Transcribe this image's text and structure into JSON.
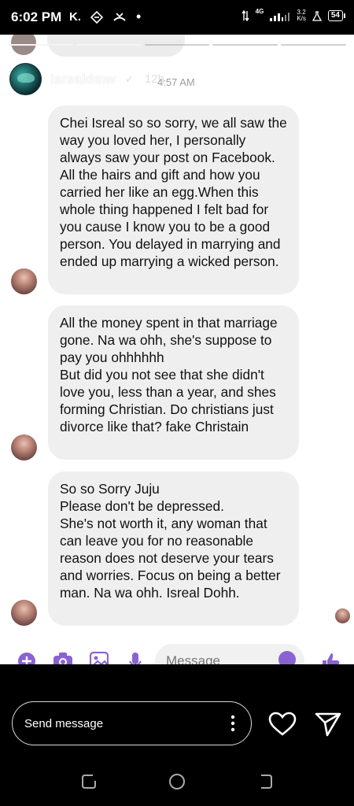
{
  "status_bar": {
    "time": "6:02 PM",
    "left_icons": [
      "K.",
      "data-saver-icon",
      "missed-call-icon",
      "•"
    ],
    "network": "4G",
    "speed_value": "3.2",
    "speed_unit": "K/s",
    "battery": "54"
  },
  "story": {
    "owner_name": "isrealdmw",
    "post_age": "12h",
    "screenshot_time": "4:57 AM"
  },
  "messages": [
    {
      "text": "Chei Isreal so so sorry, we all saw the way you loved her, I personally always saw your post on Facebook. All the hairs and gift and how you carried her like an egg.When this whole thing happened I felt bad for you cause I know you to be a good person. You delayed in marrying and ended up marrying a wicked person."
    },
    {
      "text": "All the money spent in that marriage gone. Na wa ohh, she's suppose to pay you ohhhhhh\nBut did you not see that she didn't love you, less than a year, and shes forming Christian. Do christians just divorce like that? fake Christain"
    },
    {
      "text": "So so Sorry Juju\nPlease don't be depressed.\nShe's not worth it, any woman that can leave you for no reasonable reason does not deserve your tears and worries. Focus on being a better man. Na wa ohh. Isreal Dohh."
    }
  ],
  "composer": {
    "placeholder": "Message"
  },
  "reply_bar": {
    "placeholder": "Send message"
  },
  "colors": {
    "bubble": "#efefef",
    "accent_purple": "#8a63d2",
    "background": "#000000"
  }
}
